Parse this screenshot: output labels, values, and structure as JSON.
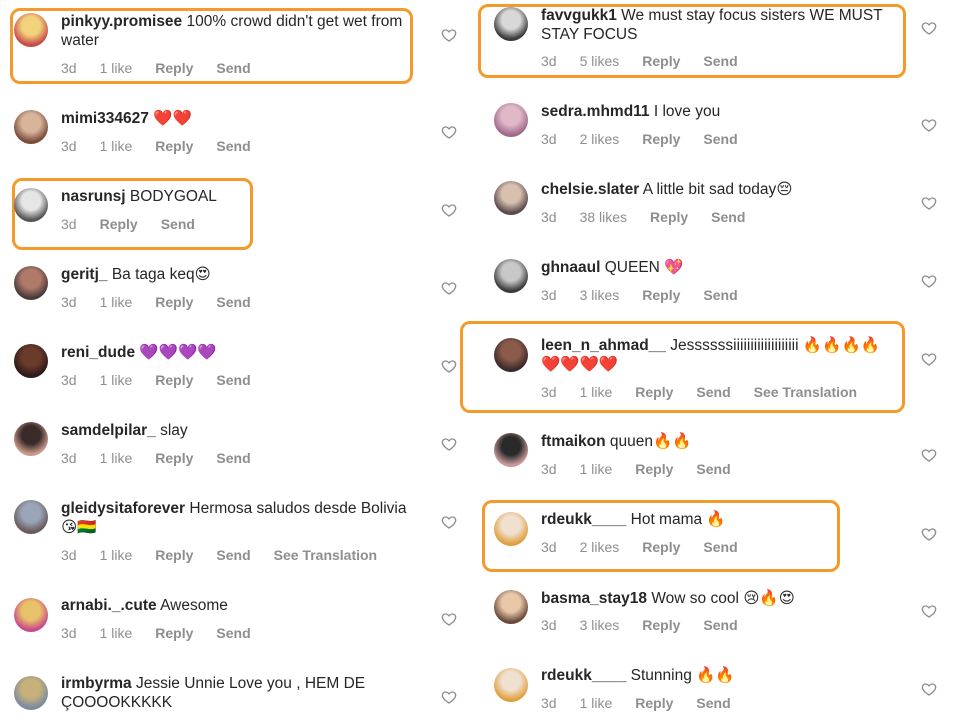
{
  "colors": {
    "highlight": "#f39a2b",
    "meta": "#8e8e8e",
    "text": "#262626"
  },
  "left": [
    {
      "user": "pinkyy.promisee",
      "text": "100% crowd didn't get wet from water",
      "time": "3d",
      "likes": "1 like",
      "reply": "Reply",
      "send": "Send",
      "translation": "",
      "highlighted": true,
      "avatar_colors": [
        "#f2d27a",
        "#c84a4a"
      ]
    },
    {
      "user": "mimi334627",
      "text": "❤️❤️",
      "time": "3d",
      "likes": "1 like",
      "reply": "Reply",
      "send": "Send",
      "translation": "",
      "highlighted": false,
      "avatar_colors": [
        "#d8b59a",
        "#7a4a3a"
      ]
    },
    {
      "user": "nasrunsj",
      "text": "BODYGOAL",
      "time": "3d",
      "likes": "",
      "reply": "Reply",
      "send": "Send",
      "translation": "",
      "highlighted": true,
      "avatar_colors": [
        "#e6e6e6",
        "#555555"
      ]
    },
    {
      "user": "geritj_",
      "text": "Ba taga keq😍",
      "time": "3d",
      "likes": "1 like",
      "reply": "Reply",
      "send": "Send",
      "translation": "",
      "highlighted": false,
      "avatar_colors": [
        "#b07a6a",
        "#4a3a3a"
      ]
    },
    {
      "user": "reni_dude",
      "text": "💜💜💜💜",
      "time": "3d",
      "likes": "1 like",
      "reply": "Reply",
      "send": "Send",
      "translation": "",
      "highlighted": false,
      "avatar_colors": [
        "#6a3a2a",
        "#2a1a1a"
      ]
    },
    {
      "user": "samdelpilar_",
      "text": "slay",
      "time": "3d",
      "likes": "1 like",
      "reply": "Reply",
      "send": "Send",
      "translation": "",
      "highlighted": false,
      "avatar_colors": [
        "#3a2a2a",
        "#c89a8a"
      ]
    },
    {
      "user": "gleidysitaforever",
      "text": "Hermosa saludos desde Bolivia 😘🇧🇴",
      "time": "3d",
      "likes": "1 like",
      "reply": "Reply",
      "send": "Send",
      "translation": "See Translation",
      "highlighted": false,
      "avatar_colors": [
        "#9aa6b8",
        "#6a5a5a"
      ]
    },
    {
      "user": "arnabi._.cute",
      "text": "Awesome",
      "time": "3d",
      "likes": "1 like",
      "reply": "Reply",
      "send": "Send",
      "translation": "",
      "highlighted": false,
      "avatar_colors": [
        "#e8c26a",
        "#c84a8a"
      ]
    },
    {
      "user": "irmbyrma",
      "text": "Jessie Unnie Love you , HEM DE ÇOOOOKKKKK",
      "time": "",
      "likes": "",
      "reply": "",
      "send": "",
      "translation": "",
      "highlighted": false,
      "avatar_colors": [
        "#c8b07a",
        "#7a8aa0"
      ]
    }
  ],
  "right": [
    {
      "user": "favvgukk1",
      "text": "We must stay focus sisters WE MUST STAY FOCUS",
      "time": "3d",
      "likes": "5 likes",
      "reply": "Reply",
      "send": "Send",
      "translation": "",
      "highlighted": true,
      "avatar_colors": [
        "#d8d8d8",
        "#3a3a3a"
      ]
    },
    {
      "user": "sedra.mhmd11",
      "text": "I love you",
      "time": "3d",
      "likes": "2 likes",
      "reply": "Reply",
      "send": "Send",
      "translation": "",
      "highlighted": false,
      "avatar_colors": [
        "#e0b8c8",
        "#a06a8a"
      ]
    },
    {
      "user": "chelsie.slater",
      "text": "A little bit sad today😔",
      "time": "3d",
      "likes": "38 likes",
      "reply": "Reply",
      "send": "Send",
      "translation": "",
      "highlighted": false,
      "avatar_colors": [
        "#d8c0b0",
        "#5a4a4a"
      ]
    },
    {
      "user": "ghnaaul",
      "text": "QUEEN 💖",
      "time": "3d",
      "likes": "3 likes",
      "reply": "Reply",
      "send": "Send",
      "translation": "",
      "highlighted": false,
      "avatar_colors": [
        "#c8c8c8",
        "#3a3a3a"
      ]
    },
    {
      "user": "leen_n_ahmad__",
      "text": "Jessssssiiiiiiiiiiiiiiiiiii 🔥🔥🔥🔥❤️❤️❤️❤️",
      "time": "3d",
      "likes": "1 like",
      "reply": "Reply",
      "send": "Send",
      "translation": "See Translation",
      "highlighted": true,
      "avatar_colors": [
        "#8a5a4a",
        "#3a2a2a"
      ]
    },
    {
      "user": "ftmaikon",
      "text": "quuen🔥🔥",
      "time": "3d",
      "likes": "1 like",
      "reply": "Reply",
      "send": "Send",
      "translation": "",
      "highlighted": false,
      "avatar_colors": [
        "#2a2a2a",
        "#c89a9a"
      ]
    },
    {
      "user": "rdeukk____",
      "text": "Hot mama 🔥",
      "time": "3d",
      "likes": "2 likes",
      "reply": "Reply",
      "send": "Send",
      "translation": "",
      "highlighted": true,
      "avatar_colors": [
        "#f0e0d0",
        "#e0a040"
      ]
    },
    {
      "user": "basma_stay18",
      "text": "Wow so cool 😢🔥😍",
      "time": "3d",
      "likes": "3 likes",
      "reply": "Reply",
      "send": "Send",
      "translation": "",
      "highlighted": false,
      "avatar_colors": [
        "#e8c8a8",
        "#6a4a3a"
      ]
    },
    {
      "user": "rdeukk____",
      "text": "Stunning 🔥🔥",
      "time": "3d",
      "likes": "1 like",
      "reply": "Reply",
      "send": "Send",
      "translation": "",
      "highlighted": false,
      "avatar_colors": [
        "#f0e0d0",
        "#e0a040"
      ]
    }
  ]
}
